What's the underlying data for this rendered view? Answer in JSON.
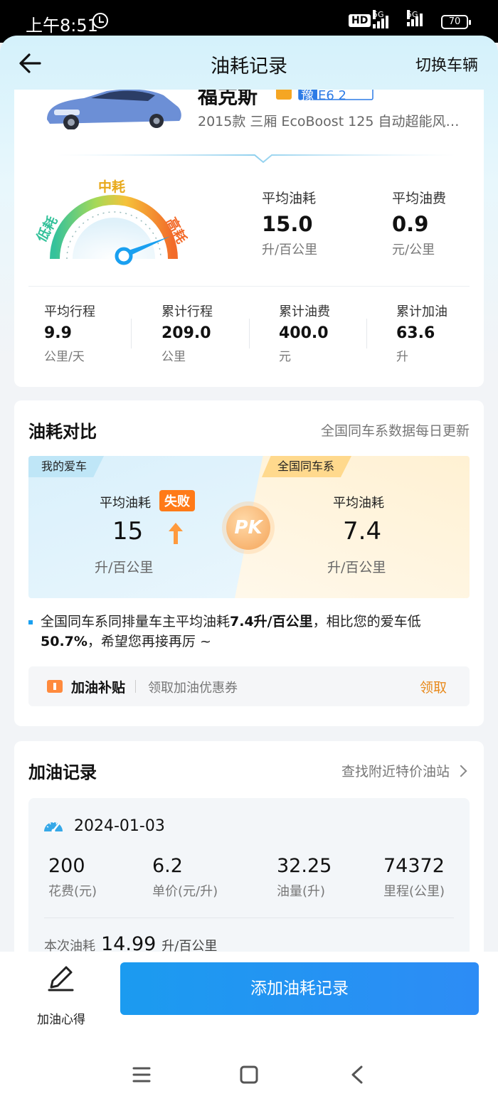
{
  "status_bar": {
    "time": "上午8:51",
    "network": "5G",
    "hd": "HD",
    "battery": "70"
  },
  "nav": {
    "title": "油耗记录",
    "right": "切换车辆"
  },
  "car": {
    "name": "福克斯",
    "plate_prefix": "豫",
    "plate": "E6 2",
    "model": "2015款 三厢 EcoBoost 125 自动超能风尚型"
  },
  "gauge": {
    "low": "低耗",
    "mid": "中耗",
    "high": "高耗",
    "level": 0.82
  },
  "summary": {
    "avg_consumption": {
      "label": "平均油耗",
      "value": "15.0",
      "unit": "升/百公里"
    },
    "avg_cost": {
      "label": "平均油费",
      "value": "0.9",
      "unit": "元/公里"
    },
    "mini": [
      {
        "label": "平均行程",
        "value": "9.9",
        "unit": "公里/天"
      },
      {
        "label": "累计行程",
        "value": "209.0",
        "unit": "公里"
      },
      {
        "label": "累计油费",
        "value": "400.0",
        "unit": "元"
      },
      {
        "label": "累计加油",
        "value": "63.6",
        "unit": "升"
      }
    ]
  },
  "compare": {
    "title": "油耗对比",
    "subtitle": "全国同车系数据每日更新",
    "mine": {
      "tag": "我的爱车",
      "label": "平均油耗",
      "value": "15",
      "unit": "升/百公里",
      "badge": "失败"
    },
    "pk": "PK",
    "national": {
      "tag": "全国同车系",
      "label": "平均油耗",
      "value": "7.4",
      "unit": "升/百公里"
    },
    "note_prefix": "全国同车系同排量车主平均油耗",
    "note_bold1": "7.4升/百公里",
    "note_mid": "，相比您的爱车低",
    "note_bold2": "50.7%",
    "note_suffix": "，希望您再接再厉 ~",
    "subsidy": {
      "title": "加油补贴",
      "desc": "领取加油优惠券",
      "action": "领取"
    }
  },
  "records": {
    "title": "加油记录",
    "link": "查找附近特价油站",
    "items": [
      {
        "date": "2024-01-03",
        "cols": [
          {
            "value": "200",
            "label": "花费(元)"
          },
          {
            "value": "6.2",
            "label": "单价(元/升)"
          },
          {
            "value": "32.25",
            "label": "油量(升)"
          },
          {
            "value": "74372",
            "label": "里程(公里)"
          }
        ],
        "consumption_label": "本次油耗",
        "consumption_value": "14.99",
        "consumption_unit": "升/百公里"
      }
    ]
  },
  "bottom": {
    "tip_label": "加油心得",
    "primary": "添加油耗记录"
  },
  "colors": {
    "accent": "#1b9bf0",
    "warn": "#ff7a18",
    "action": "#e8891b"
  }
}
